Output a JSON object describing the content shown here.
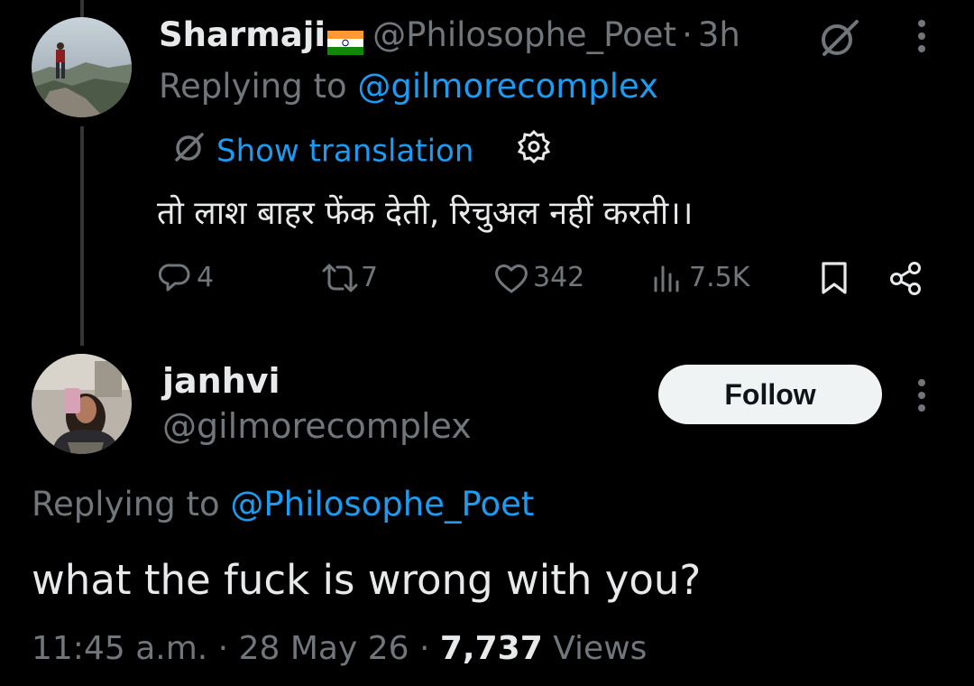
{
  "reply_tweet": {
    "display_name": "Sharmaji",
    "handle": "@Philosophe_Poet",
    "separator": "·",
    "time_ago": "3h",
    "replying_prefix": "Replying to",
    "replying_to": "@gilmorecomplex",
    "translation_label": "Show translation",
    "text": "तो लाश बाहर फेंक देती, रिचुअल नहीं करती।।",
    "stats": {
      "replies": "4",
      "reposts": "7",
      "likes": "342",
      "views": "7.5K"
    },
    "icons": [
      "grok-icon",
      "more-icon",
      "translate-icon",
      "settings-icon",
      "reply-icon",
      "repost-icon",
      "like-icon",
      "views-icon",
      "bookmark-icon",
      "share-icon"
    ],
    "flag_colors": [
      "#FF9933",
      "#FFFFFF",
      "#138808",
      "#000080"
    ]
  },
  "main_tweet": {
    "display_name": "janhvi",
    "handle": "@gilmorecomplex",
    "follow_label": "Follow",
    "replying_prefix": "Replying to",
    "replying_to": "@Philosophe_Poet",
    "text": "what the fuck is wrong with you?",
    "time": "11:45 a.m.",
    "sep1": "·",
    "date": "28 May 26",
    "sep2": "·",
    "views_count": "7,737",
    "views_label": "Views"
  },
  "colors": {
    "background": "#000000",
    "primary_text": "#e7e9ea",
    "secondary_text": "#71767b",
    "link": "#1d9bf0",
    "follow_bg": "#eff3f4"
  }
}
